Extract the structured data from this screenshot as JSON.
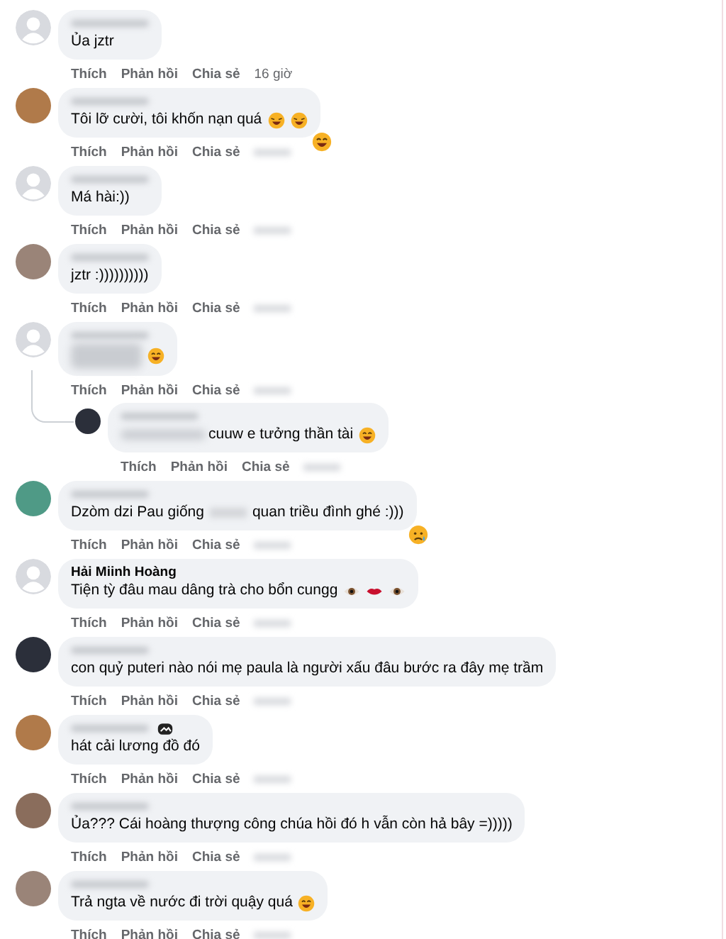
{
  "comments": [
    {
      "avatar": {
        "kind": "default"
      },
      "name_blurred": true,
      "text": "Ủa jztr",
      "actions": [
        "Thích",
        "Phản hồi",
        "Chia sẻ"
      ],
      "time": "16 giờ"
    },
    {
      "avatar": {
        "kind": "photo"
      },
      "name_blurred": true,
      "text": "Tôi lỡ cười, tôi khốn nạn quá",
      "icons": [
        {
          "kind": "rofl"
        },
        {
          "kind": "rofl"
        }
      ],
      "reaction": {
        "kind": "haha"
      },
      "actions": [
        "Thích",
        "Phản hồi",
        "Chia sẻ"
      ]
    },
    {
      "avatar": {
        "kind": "default"
      },
      "name_blurred": true,
      "text": "Má hài:))",
      "actions": [
        "Thích",
        "Phản hồi",
        "Chia sẻ"
      ]
    },
    {
      "avatar": {
        "kind": "photo"
      },
      "name_blurred": true,
      "text": "jztr :))))))))))",
      "actions": [
        "Thích",
        "Phản hồi",
        "Chia sẻ"
      ]
    },
    {
      "avatar": {
        "kind": "default"
      },
      "name_blurred": true,
      "text_blurred": true,
      "icons": [
        {
          "kind": "haha"
        }
      ],
      "actions": [
        "Thích",
        "Phản hồi",
        "Chia sẻ"
      ],
      "replies": [
        {
          "avatar": {
            "kind": "photo"
          },
          "name_blurred": true,
          "text_blurred": true,
          "text": "cuuw e tưởng thần tài",
          "icons": [
            {
              "kind": "haha"
            }
          ],
          "actions": [
            "Thích",
            "Phản hồi",
            "Chia sẻ"
          ]
        }
      ]
    },
    {
      "avatar": {
        "kind": "photo"
      },
      "name_blurred": true,
      "text": "Dzòm dzi Pau giống",
      "text_after": "quan triều đình ghé :)))",
      "reaction": {
        "kind": "sad"
      },
      "actions": [
        "Thích",
        "Phản hồi",
        "Chia sẻ"
      ]
    },
    {
      "avatar": {
        "kind": "default"
      },
      "name": "Hải Miinh Hoàng",
      "text": "Tiện tỳ đâu mau dâng trà cho bổn cungg",
      "icons": [
        {
          "kind": "eye"
        },
        {
          "kind": "lips"
        },
        {
          "kind": "eye"
        }
      ],
      "actions": [
        "Thích",
        "Phản hồi",
        "Chia sẻ"
      ]
    },
    {
      "avatar": {
        "kind": "photo"
      },
      "name_blurred": true,
      "text": "con quỷ puteri nào nói mẹ paula là người xấu đâu bước ra đây mẹ trầm",
      "actions": [
        "Thích",
        "Phản hồi",
        "Chia sẻ"
      ]
    },
    {
      "avatar": {
        "kind": "photo"
      },
      "name_blurred": true,
      "name_badge": true,
      "text": "hát cải lương đồ đó",
      "actions": [
        "Thích",
        "Phản hồi",
        "Chia sẻ"
      ]
    },
    {
      "avatar": {
        "kind": "photo"
      },
      "name_blurred": true,
      "text": "Ủa??? Cái hoàng thượng công chúa hồi đó h vẫn còn hả bây =)))))",
      "actions": [
        "Thích",
        "Phản hồi",
        "Chia sẻ"
      ]
    },
    {
      "avatar": {
        "kind": "photo"
      },
      "name_blurred": true,
      "text": "Trả ngta về nước đi trời quậy quá",
      "icons": [
        {
          "kind": "haha"
        }
      ],
      "actions": [
        "Thích",
        "Phản hồi",
        "Chia sẻ"
      ]
    }
  ]
}
